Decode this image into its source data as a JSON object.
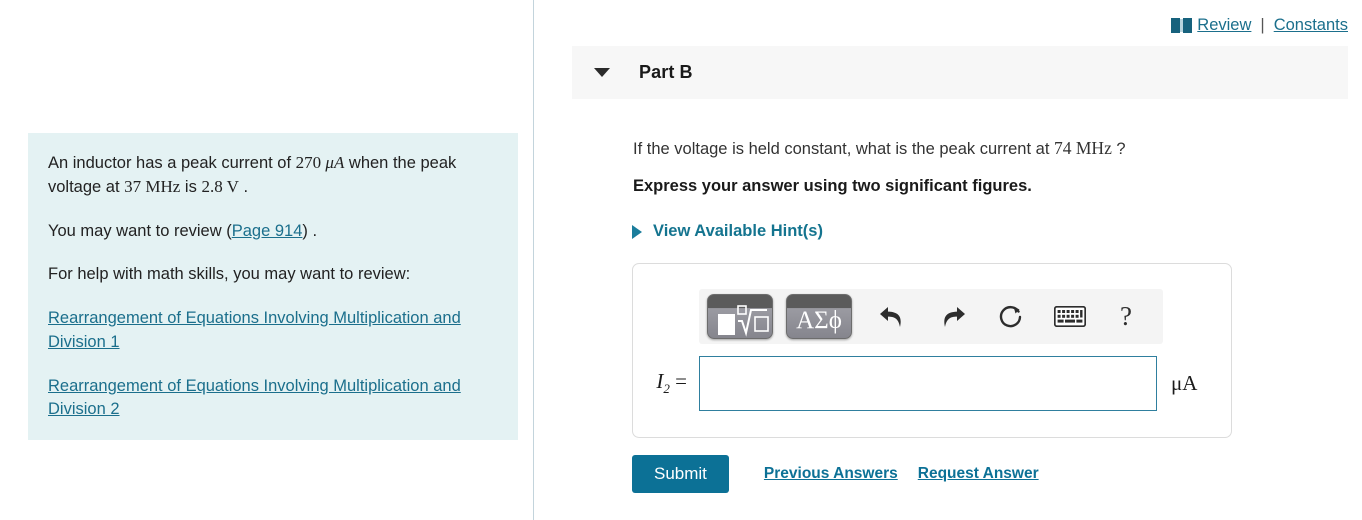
{
  "topbar": {
    "book_icon": "book-icon",
    "review_label": "Review",
    "separator": "|",
    "constants_label": "Constants"
  },
  "left_panel": {
    "problem_line1_a": "An inductor has a peak current of ",
    "problem_line1_b": "270 ",
    "problem_line1_unit": "μA",
    "problem_line1_c": " when the peak voltage at ",
    "problem_line1_freq": "37 MHz",
    "problem_line1_d": " is ",
    "problem_line1_volt": "2.8 V",
    "problem_line1_e": " .",
    "review_line_prefix": "You may want to review (",
    "review_link": "Page 914",
    "review_line_suffix": ") .",
    "math_help_intro": "For help with math skills, you may want to review:",
    "math_links": [
      "Rearrangement of Equations Involving Multiplication and Division 1",
      "Rearrangement of Equations Involving Multiplication and Division 2"
    ]
  },
  "part": {
    "caret_icon": "chevron-down-icon",
    "title": "Part B",
    "question_prefix": "If the voltage is held constant, what is the peak current at ",
    "question_value": "74 MHz",
    "question_suffix": " ?",
    "instruction": "Express your answer using two significant figures.",
    "hint_caret_icon": "chevron-right-icon",
    "hint_label": "View Available Hint(s)"
  },
  "math_toolbar": {
    "template_button_label": "math-template",
    "greek_button_label": "ΑΣϕ",
    "undo_icon": "undo-arrow-icon",
    "redo_icon": "redo-arrow-icon",
    "reset_icon": "reset-circular-arrow-icon",
    "keyboard_icon": "keyboard-icon",
    "help_label": "?"
  },
  "answer": {
    "variable": "I",
    "subscript": "2",
    "equals": "=",
    "value": "",
    "placeholder": "",
    "units": "μA"
  },
  "actions": {
    "submit_label": "Submit",
    "previous_answers_label": "Previous Answers",
    "request_answer_label": "Request Answer"
  },
  "colors": {
    "accent": "#0c7196",
    "link": "#1b6f8c",
    "panel_bg": "#e4f2f3",
    "header_bg": "#f7f7f7",
    "input_border": "#2f7f9e"
  }
}
